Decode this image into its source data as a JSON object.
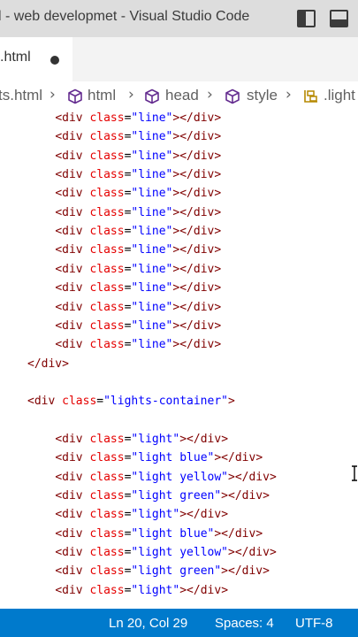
{
  "window": {
    "title": "l - web developmet - Visual Studio Code"
  },
  "tab": {
    "label": ".html",
    "dirty": true
  },
  "breadcrumb": {
    "items": [
      "ts.html",
      "html",
      "head",
      "style",
      ".light"
    ]
  },
  "code": {
    "lines": [
      {
        "indent": 8,
        "tag": "div",
        "attr": "class",
        "value": "line",
        "close": true
      },
      {
        "indent": 8,
        "tag": "div",
        "attr": "class",
        "value": "line",
        "close": true
      },
      {
        "indent": 8,
        "tag": "div",
        "attr": "class",
        "value": "line",
        "close": true
      },
      {
        "indent": 8,
        "tag": "div",
        "attr": "class",
        "value": "line",
        "close": true
      },
      {
        "indent": 8,
        "tag": "div",
        "attr": "class",
        "value": "line",
        "close": true
      },
      {
        "indent": 8,
        "tag": "div",
        "attr": "class",
        "value": "line",
        "close": true
      },
      {
        "indent": 8,
        "tag": "div",
        "attr": "class",
        "value": "line",
        "close": true
      },
      {
        "indent": 8,
        "tag": "div",
        "attr": "class",
        "value": "line",
        "close": true
      },
      {
        "indent": 8,
        "tag": "div",
        "attr": "class",
        "value": "line",
        "close": true
      },
      {
        "indent": 8,
        "tag": "div",
        "attr": "class",
        "value": "line",
        "close": true
      },
      {
        "indent": 8,
        "tag": "div",
        "attr": "class",
        "value": "line",
        "close": true
      },
      {
        "indent": 8,
        "tag": "div",
        "attr": "class",
        "value": "line",
        "close": true
      },
      {
        "indent": 8,
        "tag": "div",
        "attr": "class",
        "value": "line",
        "close": true
      },
      {
        "indent": 4,
        "closing": "div"
      },
      {
        "blank": true
      },
      {
        "indent": 4,
        "tag": "div",
        "attr": "class",
        "value": "lights-container",
        "close": false
      },
      {
        "blank": true
      },
      {
        "indent": 8,
        "tag": "div",
        "attr": "class",
        "value": "light",
        "close": true
      },
      {
        "indent": 8,
        "tag": "div",
        "attr": "class",
        "value": "light blue",
        "close": true
      },
      {
        "indent": 8,
        "tag": "div",
        "attr": "class",
        "value": "light yellow",
        "close": true
      },
      {
        "indent": 8,
        "tag": "div",
        "attr": "class",
        "value": "light green",
        "close": true
      },
      {
        "indent": 8,
        "tag": "div",
        "attr": "class",
        "value": "light",
        "close": true
      },
      {
        "indent": 8,
        "tag": "div",
        "attr": "class",
        "value": "light blue",
        "close": true
      },
      {
        "indent": 8,
        "tag": "div",
        "attr": "class",
        "value": "light yellow",
        "close": true
      },
      {
        "indent": 8,
        "tag": "div",
        "attr": "class",
        "value": "light green",
        "close": true
      },
      {
        "indent": 8,
        "tag": "div",
        "attr": "class",
        "value": "light",
        "close": true
      }
    ]
  },
  "status": {
    "position": "Ln 20, Col 29",
    "spaces": "Spaces: 4",
    "encoding": "UTF-8"
  },
  "icons": {
    "sidebar_toggle": "toggle-primary-sidebar-icon",
    "panel_toggle": "toggle-panel-icon",
    "breadcrumb_symbol": "cube-symbol-icon",
    "style_rule": "css-rule-icon"
  },
  "colors": {
    "titlebar": "#dddddd",
    "statusbar": "#007acc",
    "tag": "#800000",
    "attribute": "#e50000",
    "string": "#0000ff"
  }
}
